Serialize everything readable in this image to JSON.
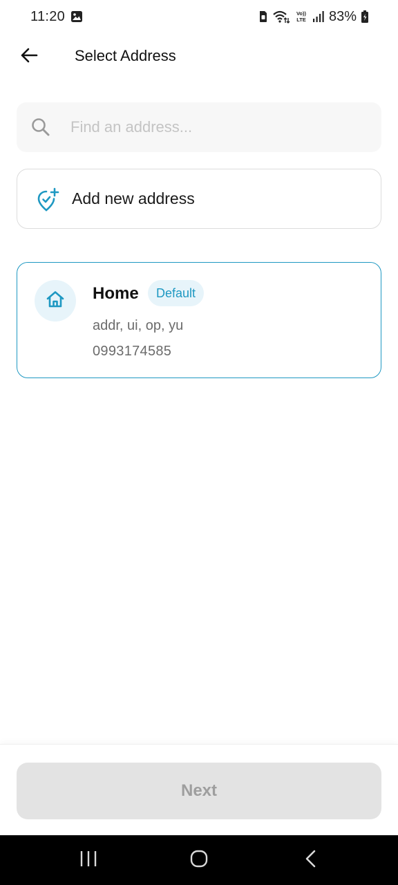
{
  "status_bar": {
    "time": "11:20",
    "battery": "83%",
    "icons": [
      "image-icon",
      "sim-icon",
      "wifi-icon",
      "volte-icon",
      "signal-icon",
      "battery-icon"
    ]
  },
  "header": {
    "title": "Select Address",
    "back_icon": "arrow-left-icon"
  },
  "search": {
    "placeholder": "Find an address...",
    "value": "",
    "icon": "search-icon"
  },
  "add_address": {
    "label": "Add new address",
    "icon": "location-plus-icon"
  },
  "addresses": [
    {
      "name": "Home",
      "badge": "Default",
      "line": "addr, ui, op, yu",
      "phone": "0993174585",
      "icon": "home-icon",
      "selected": true
    }
  ],
  "footer": {
    "next_label": "Next",
    "enabled": false
  },
  "nav_bar": {
    "buttons": [
      "recents-icon",
      "home-circle-icon",
      "back-chevron-icon"
    ]
  },
  "colors": {
    "accent": "#1e98c2",
    "accent_light": "#e7f4fa",
    "disabled_bg": "#e3e3e3",
    "disabled_text": "#9e9e9e",
    "nav_bg": "#000000"
  }
}
